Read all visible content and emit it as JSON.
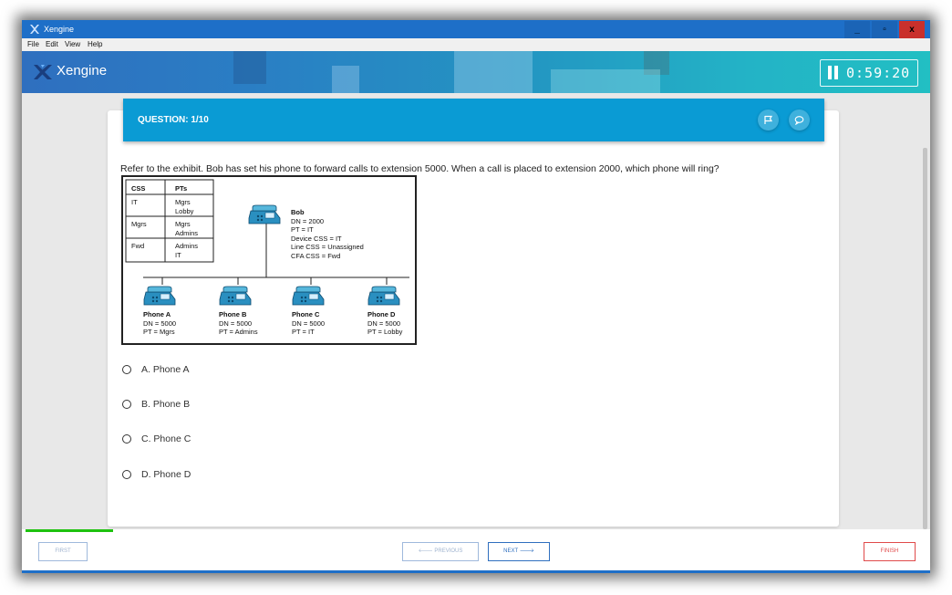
{
  "window": {
    "title": "Xengine"
  },
  "titlebar": {
    "minimize_label": "_",
    "maximize_label": "▫",
    "close_label": "x"
  },
  "menu": [
    "File",
    "Edit",
    "View",
    "Help"
  ],
  "header": {
    "brand": "Xengine",
    "timer": "0:59:20"
  },
  "question": {
    "title": "QUESTION: 1/10",
    "text": "Refer to the exhibit. Bob has set his phone to forward calls to extension 5000. When a call is placed to extension 2000, which phone will ring?"
  },
  "exhibit": {
    "table_headers": [
      "CSS",
      "PTs"
    ],
    "table_rows": [
      [
        "IT",
        "Mgrs",
        "Lobby"
      ],
      [
        "Mgrs",
        "Mgrs",
        "Admins"
      ],
      [
        "Fwd",
        "Admins",
        "IT"
      ]
    ],
    "bob": [
      "Bob",
      "DN = 2000",
      "PT = IT",
      "Device CSS = IT",
      "Line CSS = Unassigned",
      "CFA CSS = Fwd"
    ],
    "phones": [
      {
        "name": "Phone A",
        "dn": "DN = 5000",
        "pt": "PT = Mgrs"
      },
      {
        "name": "Phone B",
        "dn": "DN = 5000",
        "pt": "PT = Admins"
      },
      {
        "name": "Phone C",
        "dn": "DN = 5000",
        "pt": "PT = IT"
      },
      {
        "name": "Phone D",
        "dn": "DN = 5000",
        "pt": "PT = Lobby"
      }
    ]
  },
  "options": [
    {
      "label": "A. Phone A"
    },
    {
      "label": "B. Phone B"
    },
    {
      "label": "C. Phone C"
    },
    {
      "label": "D. Phone D"
    }
  ],
  "footer": {
    "progress": 0.1,
    "first": "FIRST",
    "previous": "🡐 PREVIOUS",
    "next": "NEXT 🡒",
    "finish": "FINISH"
  },
  "colors": {
    "titlebar": "#1e6fc8",
    "question_bar": "#0a9bd4",
    "progress": "#1ec20f",
    "finish": "#e04a4a",
    "phone": "#2a8fc0"
  }
}
